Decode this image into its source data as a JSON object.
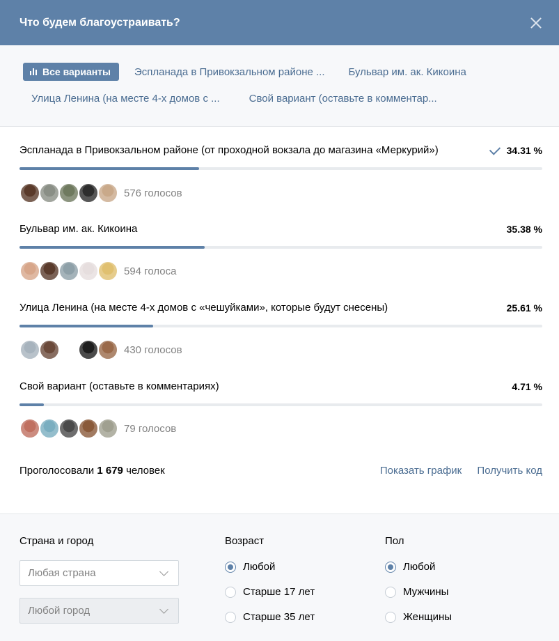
{
  "header": {
    "title": "Что будем благоустраивать?"
  },
  "tabs": {
    "row1": [
      "Все варианты",
      "Эспланада в Привокзальном районе ...",
      "Бульвар им. ак. Кикоина"
    ],
    "row2": [
      "Улица Ленина (на месте 4-х домов с ...",
      "Свой вариант (оставьте в комментар..."
    ]
  },
  "options": [
    {
      "text": "Эспланада в Привокзальном районе (от проходной вокзала до магазина «Меркурий»)",
      "percent_label": "34.31 %",
      "percent": 34.31,
      "votes_label": "576 голосов",
      "checked": true
    },
    {
      "text": "Бульвар им. ак. Кикоина",
      "percent_label": "35.38 %",
      "percent": 35.38,
      "votes_label": "594 голоса",
      "checked": false
    },
    {
      "text": "Улица Ленина (на месте 4-х домов с «чешуйками», которые будут снесены)",
      "percent_label": "25.61 %",
      "percent": 25.61,
      "votes_label": "430 голосов",
      "checked": false
    },
    {
      "text": "Свой вариант (оставьте в комментариях)",
      "percent_label": "4.71 %",
      "percent": 4.71,
      "votes_label": "79 голосов",
      "checked": false
    }
  ],
  "summary": {
    "prefix": "Проголосовали",
    "count": "1 679",
    "suffix": "человек",
    "show_chart": "Показать график",
    "get_code": "Получить код"
  },
  "filters": {
    "location_title": "Страна и город",
    "country_placeholder": "Любая страна",
    "city_placeholder": "Любой город",
    "age_title": "Возраст",
    "age_options": [
      "Любой",
      "Старше 17 лет",
      "Старше 35 лет"
    ],
    "age_selected": 0,
    "sex_title": "Пол",
    "sex_options": [
      "Любой",
      "Мужчины",
      "Женщины"
    ],
    "sex_selected": 0
  },
  "colors": {
    "accent": "#5e81a8",
    "link": "#4a6c91",
    "avatars": [
      [
        "#5a3a2a",
        "#8a8f86",
        "#6f7a5f",
        "#2d2d2d",
        "#c9a98a"
      ],
      [
        "#d7a68a",
        "#5a3b2c",
        "#8ea0a8",
        "#e6dede",
        "#e0c070"
      ],
      [
        "#a7b3bd",
        "#6b4a3a",
        "#555",
        "#1e1e1e",
        "#9a6a4a"
      ],
      [
        "#c07060",
        "#7aaec0",
        "#4a4a4a",
        "#8a5a3a",
        "#a0a090"
      ]
    ]
  }
}
